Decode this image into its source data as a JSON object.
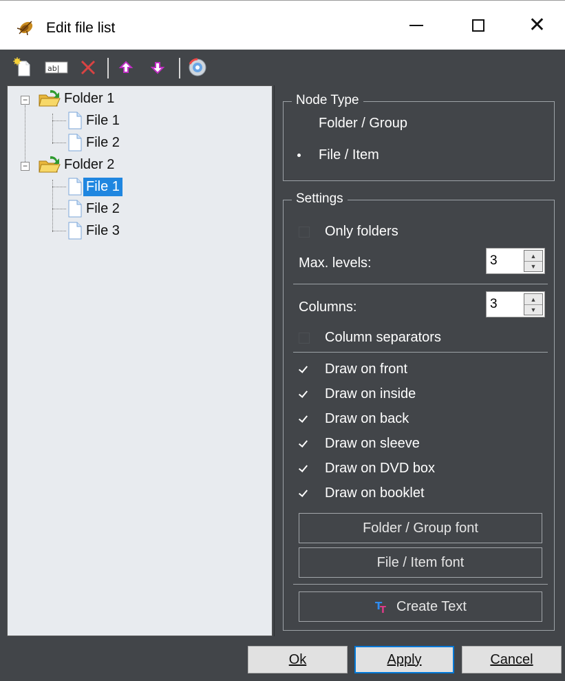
{
  "window": {
    "title": "Edit file list",
    "icon": "beetle-app-icon"
  },
  "toolbar": {
    "buttons": [
      {
        "name": "new-item-icon"
      },
      {
        "name": "rename-icon",
        "text": "ab|"
      },
      {
        "name": "delete-icon"
      },
      {
        "name": "move-up-icon"
      },
      {
        "name": "move-down-icon"
      },
      {
        "name": "scan-disc-icon"
      }
    ]
  },
  "tree": {
    "nodes": [
      {
        "label": "Folder 1",
        "type": "folder"
      },
      {
        "label": "File 1",
        "type": "file"
      },
      {
        "label": "File 2",
        "type": "file"
      },
      {
        "label": "Folder 2",
        "type": "folder"
      },
      {
        "label": "File 1",
        "type": "file",
        "selected": true
      },
      {
        "label": "File 2",
        "type": "file"
      },
      {
        "label": "File 3",
        "type": "file"
      }
    ]
  },
  "node_type": {
    "title": "Node Type",
    "options": [
      "Folder / Group",
      "File / Item"
    ],
    "selected": "File / Item"
  },
  "settings": {
    "title": "Settings",
    "only_folders": "Only folders",
    "max_levels_label": "Max. levels:",
    "max_levels_value": "3",
    "columns_label": "Columns:",
    "columns_value": "3",
    "column_separators": "Column separators",
    "draw_options": [
      {
        "label": "Draw on front",
        "checked": true
      },
      {
        "label": "Draw on inside",
        "checked": true
      },
      {
        "label": "Draw on back",
        "checked": true
      },
      {
        "label": "Draw on sleeve",
        "checked": true
      },
      {
        "label": "Draw on DVD box",
        "checked": true
      },
      {
        "label": "Draw on booklet",
        "checked": true
      }
    ],
    "folder_font_button": "Folder / Group font",
    "file_font_button": "File / Item font",
    "create_text_button": "Create Text"
  },
  "footer": {
    "ok_label": "Ok",
    "apply_label": "Apply",
    "cancel_label": "Cancel"
  },
  "colors": {
    "panel": "#424549",
    "tree_bg": "#e8ebef",
    "selection": "#1f86e0"
  }
}
